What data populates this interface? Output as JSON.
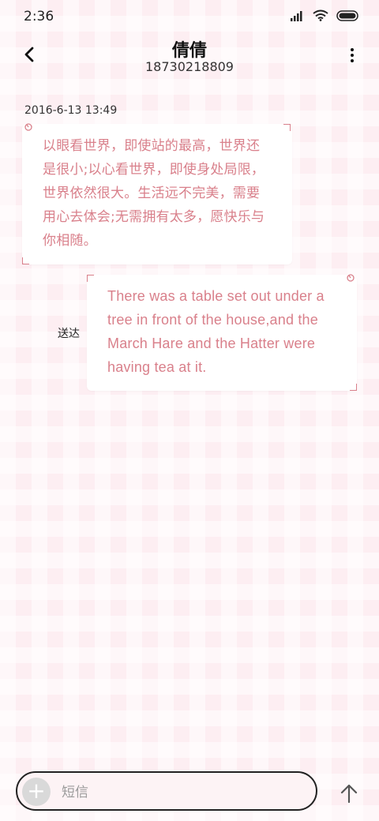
{
  "status_bar": {
    "time": "2:36",
    "icons": [
      "signal-icon",
      "wifi-icon",
      "battery-icon"
    ]
  },
  "header": {
    "contact_name": "倩倩",
    "phone_number": "18730218809",
    "back_icon": "back-arrow-icon",
    "more_icon": "more-vert-icon"
  },
  "conversation": {
    "timestamp": "2016-6-13 13:49",
    "messages": [
      {
        "direction": "incoming",
        "text": "以眼看世界，即使站的最高，世界还是很小;以心看世界，即使身处局限，世界依然很大。生活远不完美，需要用心去体会;无需拥有太多，愿快乐与你相随。"
      },
      {
        "direction": "outgoing",
        "text": "There was a table set out under a tree in front of the house,and the March Hare and the Hatter were having tea at it.",
        "status": "送达"
      }
    ]
  },
  "composer": {
    "placeholder": "短信",
    "value": "",
    "add_icon": "plus-icon",
    "send_icon": "send-arrow-icon"
  },
  "colors": {
    "bubble_text": "#d9808b",
    "background": "#fdeef2",
    "bubble": "#ffffff"
  }
}
